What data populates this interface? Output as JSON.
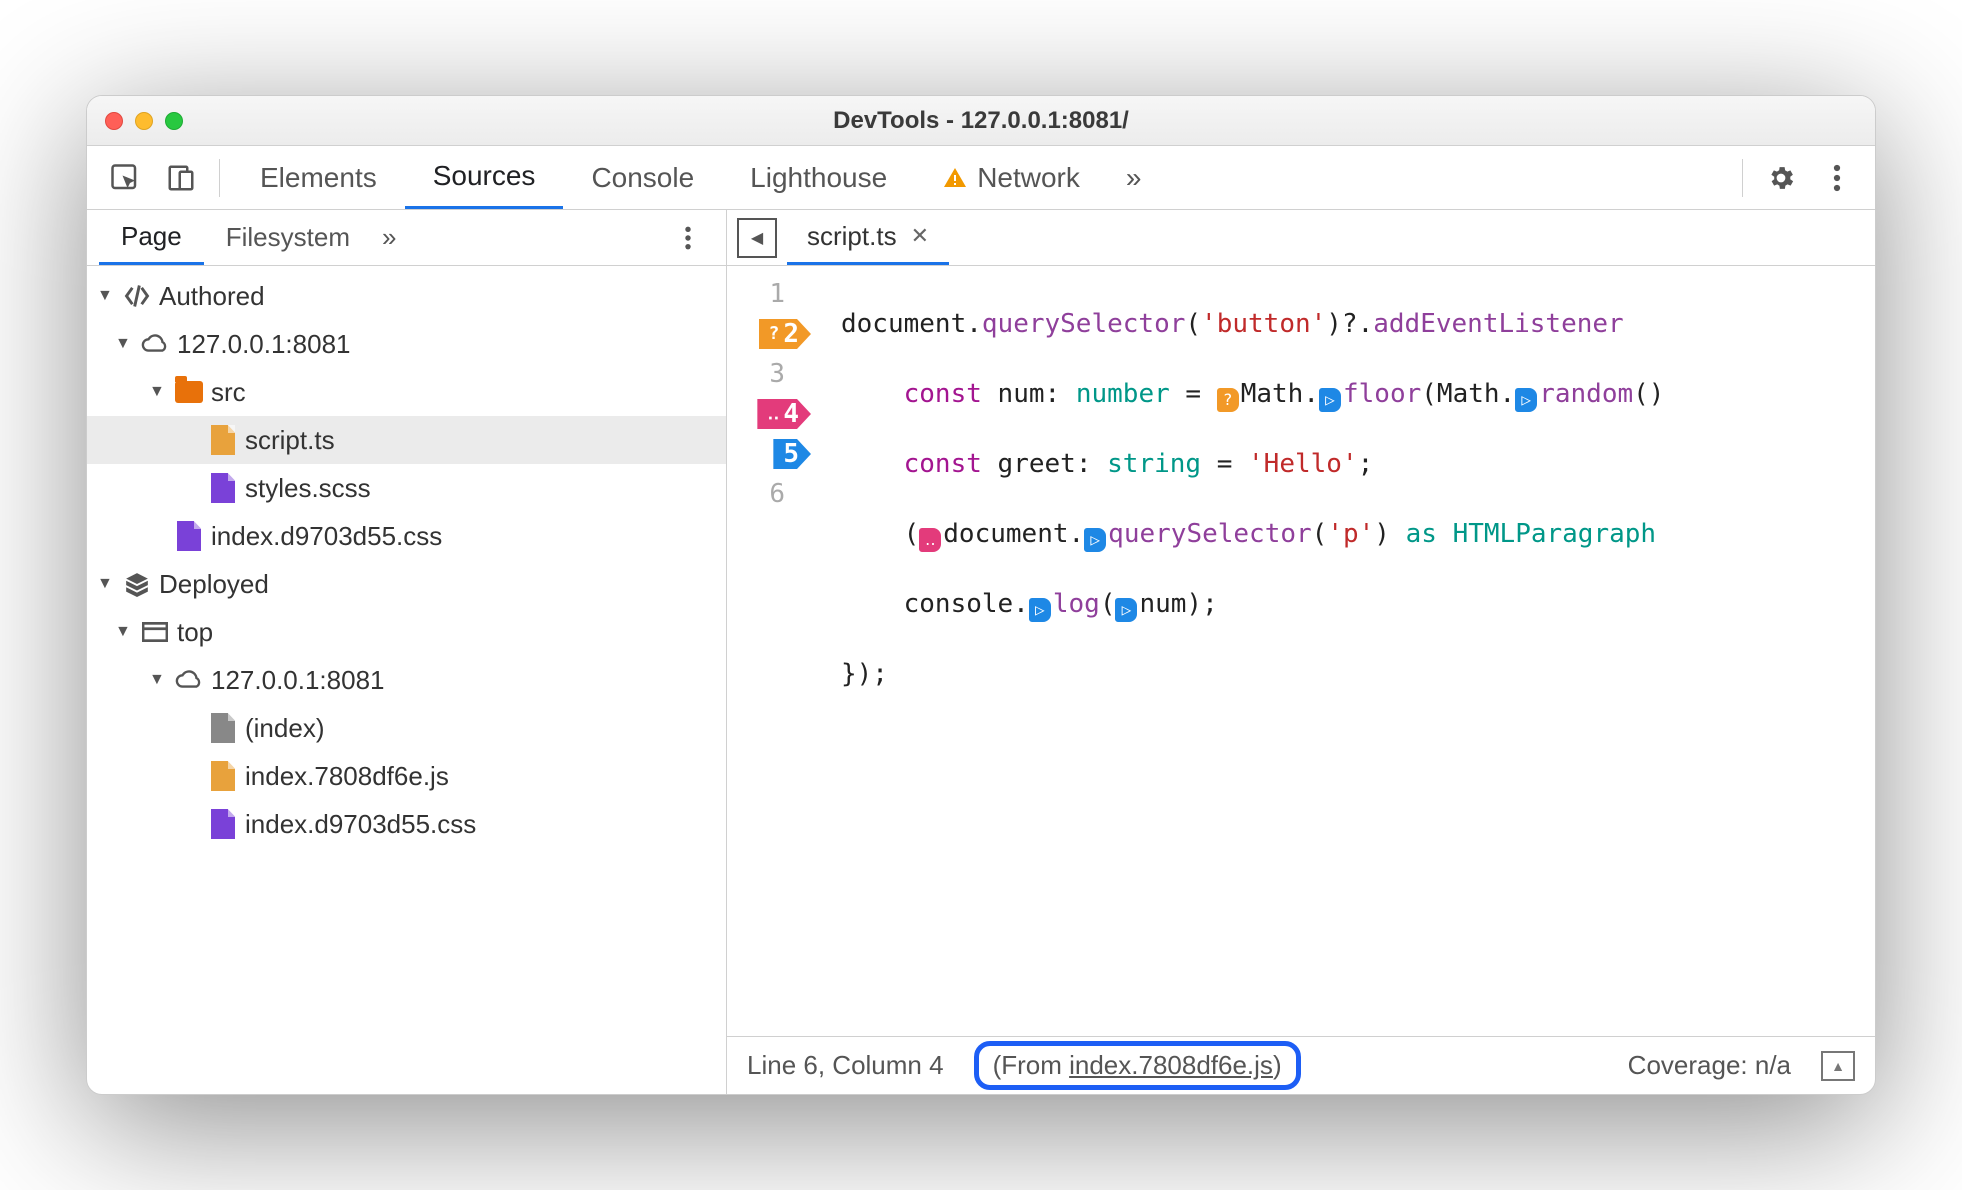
{
  "window": {
    "title": "DevTools - 127.0.0.1:8081/"
  },
  "toolbar": {
    "tabs": [
      {
        "label": "Elements",
        "active": false
      },
      {
        "label": "Sources",
        "active": true
      },
      {
        "label": "Console",
        "active": false
      },
      {
        "label": "Lighthouse",
        "active": false
      },
      {
        "label": "Network",
        "active": false,
        "warning": true
      }
    ],
    "overflow_glyph": "»"
  },
  "sidebar": {
    "tabs": [
      {
        "label": "Page",
        "active": true
      },
      {
        "label": "Filesystem",
        "active": false
      }
    ],
    "overflow_glyph": "»",
    "tree": {
      "authored_label": "Authored",
      "host1": "127.0.0.1:8081",
      "src_label": "src",
      "file_script": "script.ts",
      "file_styles": "styles.scss",
      "file_indexcss_auth": "index.d9703d55.css",
      "deployed_label": "Deployed",
      "top_label": "top",
      "host2": "127.0.0.1:8081",
      "file_index": "(index)",
      "file_indexjs": "index.7808df6e.js",
      "file_indexcss_dep": "index.d9703d55.css"
    }
  },
  "editor": {
    "open_file": "script.ts",
    "breakpoints": {
      "2": {
        "kind": "conditional",
        "glyph": "?"
      },
      "4": {
        "kind": "logpoint",
        "glyph": "‥"
      },
      "5": {
        "kind": "breakpoint",
        "glyph": ""
      }
    },
    "code_lines": [
      "document.querySelector('button')?.addEventListener",
      "    const num: number = Math.floor(Math.random()",
      "    const greet: string = 'Hello';",
      "    (document.querySelector('p') as HTMLParagraph",
      "    console.log(num);",
      "});"
    ]
  },
  "statusbar": {
    "position": "Line 6, Column 4",
    "from_prefix": "(From ",
    "from_link": "index.7808df6e.js",
    "from_suffix": ")",
    "coverage": "Coverage: n/a"
  }
}
